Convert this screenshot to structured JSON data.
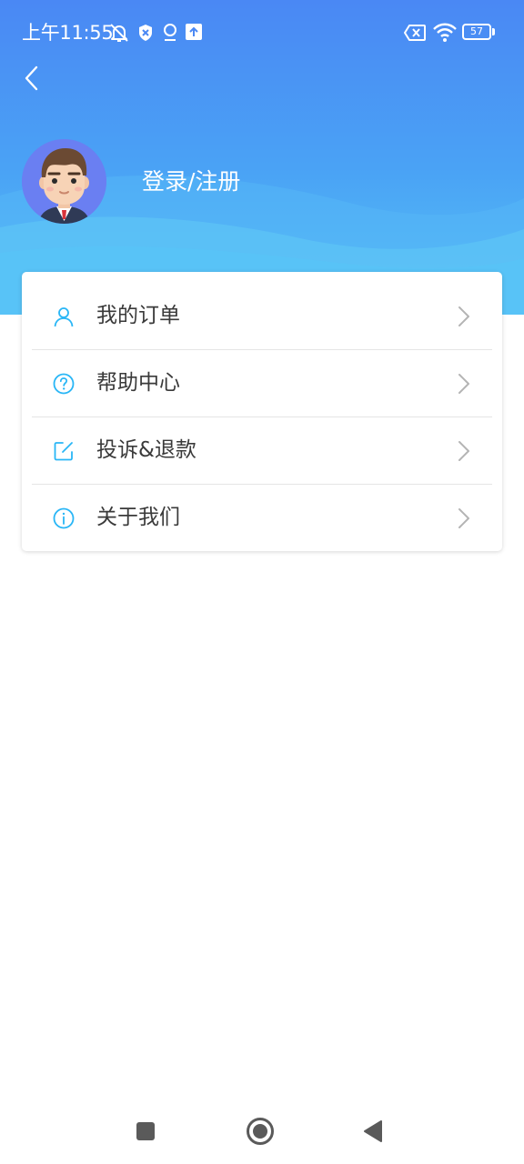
{
  "status_bar": {
    "time": "上午11:55",
    "battery_level": "57",
    "icons": [
      "bell-muted-icon",
      "shield-icon",
      "location-icon",
      "upload-icon",
      "sim-x-icon",
      "wifi-icon",
      "battery-icon"
    ]
  },
  "header": {
    "back_icon": "chevron-left-icon",
    "avatar_icon": "user-avatar",
    "login_label": "登录/注册"
  },
  "menu": {
    "items": [
      {
        "label": "我的订单",
        "icon": "user-icon"
      },
      {
        "label": "帮助中心",
        "icon": "question-circle-icon"
      },
      {
        "label": "投诉&退款",
        "icon": "edit-square-icon"
      },
      {
        "label": "关于我们",
        "icon": "info-circle-icon"
      }
    ],
    "chevron_icon": "chevron-right-icon"
  },
  "nav_bar": {
    "buttons": [
      "recents-square-icon",
      "home-circle-icon",
      "back-triangle-icon"
    ]
  },
  "colors": {
    "header_top": "#4a88f4",
    "header_bottom": "#57c3f6",
    "icon_accent": "#29b6f6",
    "text": "#3a3a3a",
    "chevron": "#b4b4b4",
    "divider": "#e5e5e5"
  }
}
